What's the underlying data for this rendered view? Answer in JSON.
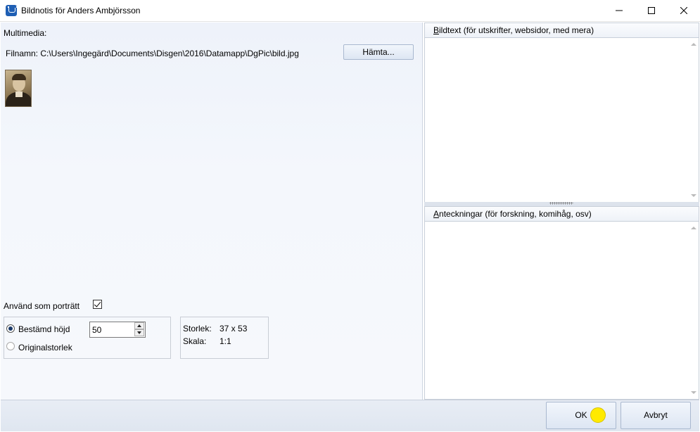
{
  "window": {
    "title": "Bildnotis för Anders Ambjörsson",
    "controls": [
      "minimize-icon",
      "maximize-icon",
      "close-icon"
    ]
  },
  "left": {
    "multimedia_label": "Multimedia:",
    "filename_label": "Filnamn:  C:\\Users\\Ingegärd\\Documents\\Disgen\\2016\\Datamapp\\DgPic\\bild.jpg",
    "fetch_button": "Hämta...",
    "use_as_portrait_label": "Använd som porträtt",
    "use_as_portrait_checked": true,
    "size_options": {
      "fixed_height_label": "Bestämd höjd",
      "fixed_height_value": "50",
      "original_size_label": "Originalstorlek",
      "selected": "fixed_height"
    },
    "info": {
      "size_label": "Storlek:",
      "size_value": "37 x 53",
      "scale_label": "Skala:",
      "scale_value": "1:1"
    }
  },
  "right": {
    "caption_header_first": "B",
    "caption_header_rest": "ildtext (för utskrifter, websidor, med mera)",
    "notes_header_first": "A",
    "notes_header_rest": "nteckningar (för forskning, komihåg, osv)"
  },
  "footer": {
    "ok_label": "OK",
    "cancel_label": "Avbryt"
  },
  "colors": {
    "accent": "#1f5fb4",
    "cursor_highlight": "#ffea00"
  }
}
